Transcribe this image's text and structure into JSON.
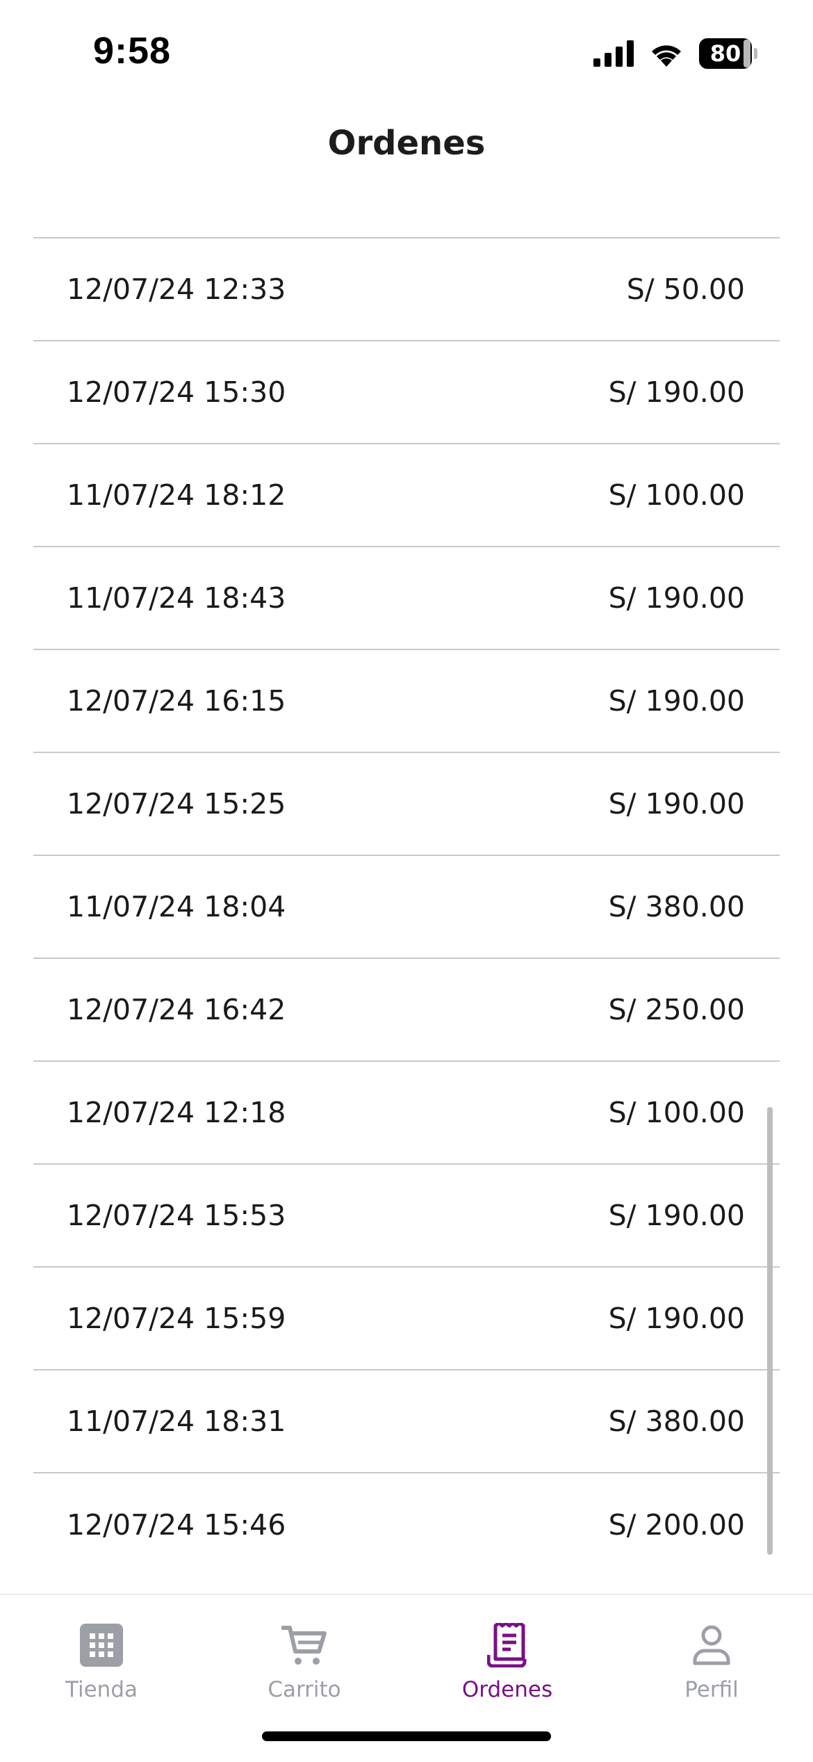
{
  "status_bar": {
    "time": "9:58",
    "battery": "80"
  },
  "header": {
    "title": "Ordenes"
  },
  "orders": [
    {
      "date": "12/07/24 12:33",
      "total": "S/ 50.00"
    },
    {
      "date": "12/07/24 15:30",
      "total": "S/ 190.00"
    },
    {
      "date": "11/07/24 18:12",
      "total": "S/ 100.00"
    },
    {
      "date": "11/07/24 18:43",
      "total": "S/ 190.00"
    },
    {
      "date": "12/07/24 16:15",
      "total": "S/ 190.00"
    },
    {
      "date": "12/07/24 15:25",
      "total": "S/ 190.00"
    },
    {
      "date": "11/07/24 18:04",
      "total": "S/ 380.00"
    },
    {
      "date": "12/07/24 16:42",
      "total": "S/ 250.00"
    },
    {
      "date": "12/07/24 12:18",
      "total": "S/ 100.00"
    },
    {
      "date": "12/07/24 15:53",
      "total": "S/ 190.00"
    },
    {
      "date": "12/07/24 15:59",
      "total": "S/ 190.00"
    },
    {
      "date": "11/07/24 18:31",
      "total": "S/ 380.00"
    },
    {
      "date": "12/07/24 15:46",
      "total": "S/ 200.00"
    }
  ],
  "tab_bar": {
    "tabs": [
      {
        "label": "Tienda",
        "icon": "grid-icon",
        "active": false
      },
      {
        "label": "Carrito",
        "icon": "cart-icon",
        "active": false
      },
      {
        "label": "Ordenes",
        "icon": "receipt-icon",
        "active": true
      },
      {
        "label": "Perfil",
        "icon": "person-icon",
        "active": false
      }
    ]
  },
  "colors": {
    "accent": "#7a0f86",
    "inactive_tab": "#9c9fa6",
    "divider": "#c9c9cc"
  }
}
